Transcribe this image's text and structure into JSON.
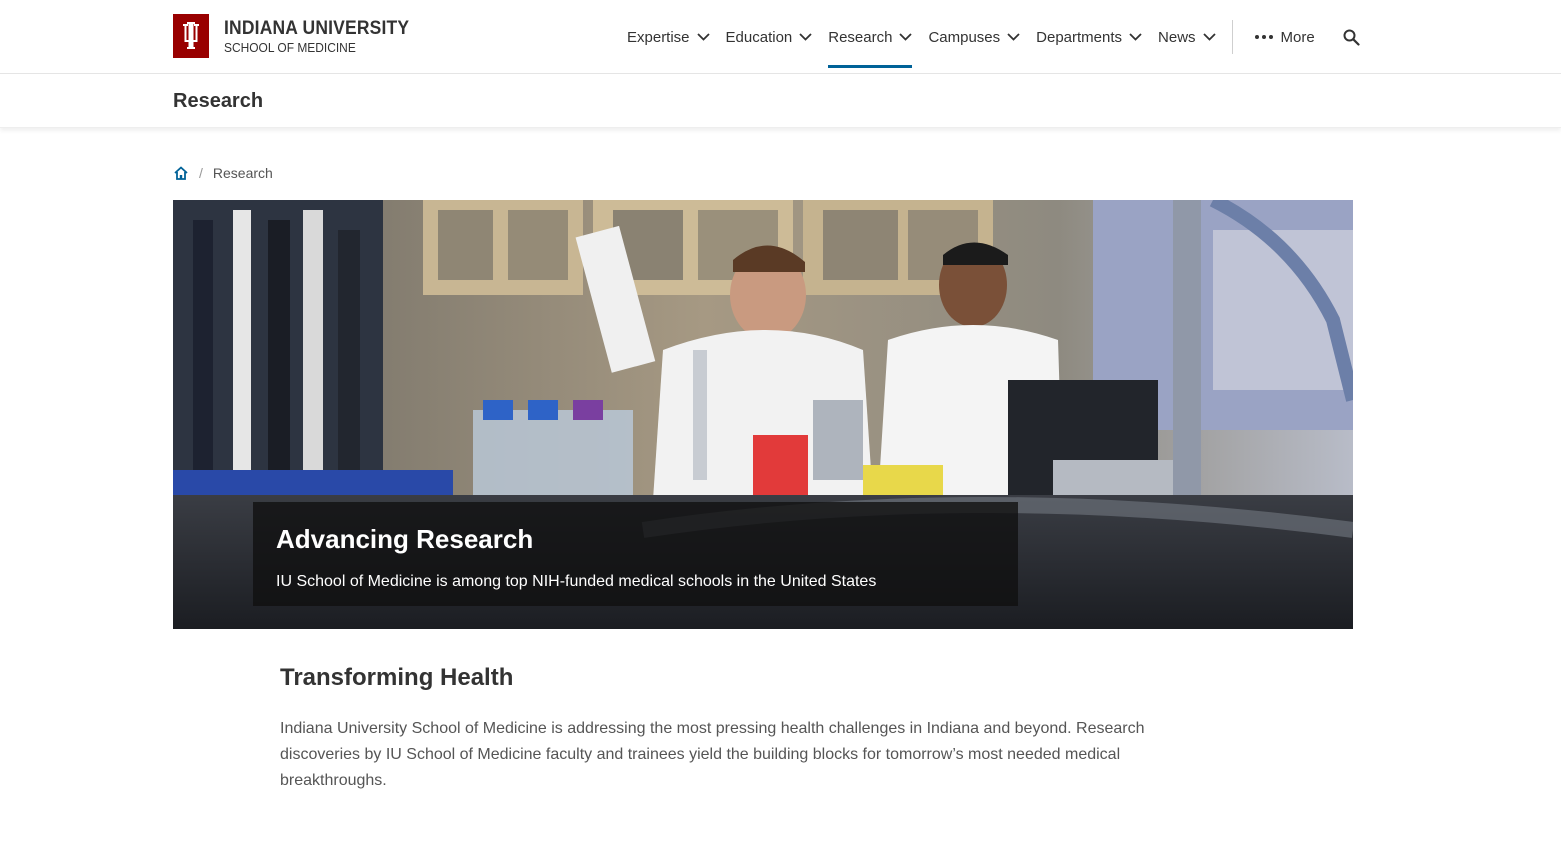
{
  "brand": {
    "university": "INDIANA UNIVERSITY",
    "school": "SCHOOL OF MEDICINE",
    "color": "#990000"
  },
  "nav": {
    "items": [
      {
        "label": "Expertise"
      },
      {
        "label": "Education"
      },
      {
        "label": "Research"
      },
      {
        "label": "Campuses"
      },
      {
        "label": "Departments"
      },
      {
        "label": "News"
      }
    ],
    "active": "Research",
    "more_label": "More",
    "accent": "#006298"
  },
  "section": {
    "title": "Research"
  },
  "breadcrumb": {
    "current": "Research"
  },
  "hero": {
    "title": "Advancing Research",
    "subtitle": "IU School of Medicine is among top NIH-funded medical schools in the United States"
  },
  "main": {
    "heading": "Transforming Health",
    "paragraph": "Indiana University School of Medicine is addressing the most pressing health challenges in Indiana and beyond. Research discoveries by IU School of Medicine faculty and trainees yield the building blocks for tomorrow’s most needed medical breakthroughs."
  }
}
